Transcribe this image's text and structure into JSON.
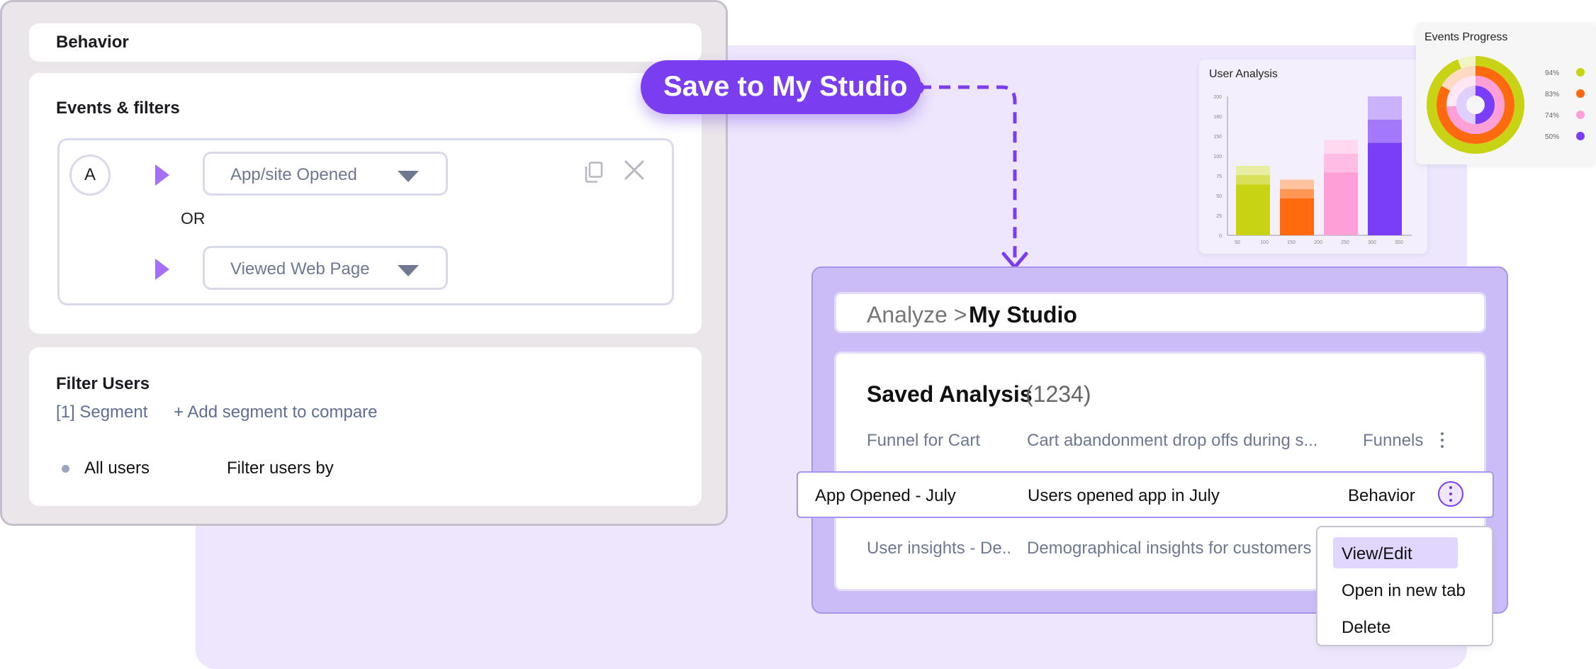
{
  "behavior": {
    "title": "Behavior"
  },
  "events": {
    "title": "Events & filters",
    "group_label": "A",
    "event_1": "App/site Opened",
    "or_label": "OR",
    "event_2": "Viewed Web Page"
  },
  "filter_users": {
    "title": "Filter Users",
    "segment_link": "[1] Segment",
    "add_segment": "+ Add segment to compare",
    "all_users": "All users",
    "filter_by": "Filter users by"
  },
  "save_pill": {
    "label": "Save to My Studio"
  },
  "breadcrumb": {
    "parent": "Analyze >",
    "current": "My Studio"
  },
  "saved_analysis": {
    "title": "Saved Analysis",
    "count": "(1234)",
    "rows": [
      {
        "name": "Funnel for Cart",
        "description": "Cart abandonment drop offs during s...",
        "type": "Funnels"
      },
      {
        "name": "App Opened - July",
        "description": "Users opened app in July",
        "type": "Behavior"
      },
      {
        "name": "User insights - De..",
        "description": "Demographical insights for customers",
        "type": ""
      }
    ]
  },
  "context_menu": {
    "items": [
      "View/Edit",
      "Open in new tab",
      "Delete"
    ]
  },
  "colors": {
    "accent": "#7a3df0",
    "panel": "#cbbcf7",
    "lavender_bg": "#ede6fc"
  },
  "chart_data": [
    {
      "type": "bar",
      "title": "User Analysis",
      "categories": [
        "100",
        "150",
        "250",
        "350"
      ],
      "x_ticks": [
        "50",
        "100",
        "150",
        "200",
        "250",
        "300",
        "350"
      ],
      "y_ticks": [
        "0",
        "25",
        "50",
        "75",
        "100",
        "150",
        "180",
        "200"
      ],
      "series": [
        {
          "values": [
            55,
            40,
            68,
            100
          ],
          "color_shade": "base"
        },
        {
          "values": [
            10,
            10,
            20,
            25
          ],
          "color_shade": "mid"
        },
        {
          "values": [
            10,
            10,
            15,
            25
          ],
          "color_shade": "light"
        }
      ],
      "bar_colors": [
        "#c8d313",
        "#ff6a0f",
        "#ff9fd8",
        "#7b3ef8"
      ]
    },
    {
      "type": "pie",
      "title": "Events Progress",
      "series": [
        {
          "label": "94%",
          "value": 94,
          "color": "#c8d313"
        },
        {
          "label": "83%",
          "value": 83,
          "color": "#ff6a0f"
        },
        {
          "label": "74%",
          "value": 74,
          "color": "#ff9fd8"
        },
        {
          "label": "50%",
          "value": 50,
          "color": "#7b3ef8"
        }
      ]
    }
  ]
}
